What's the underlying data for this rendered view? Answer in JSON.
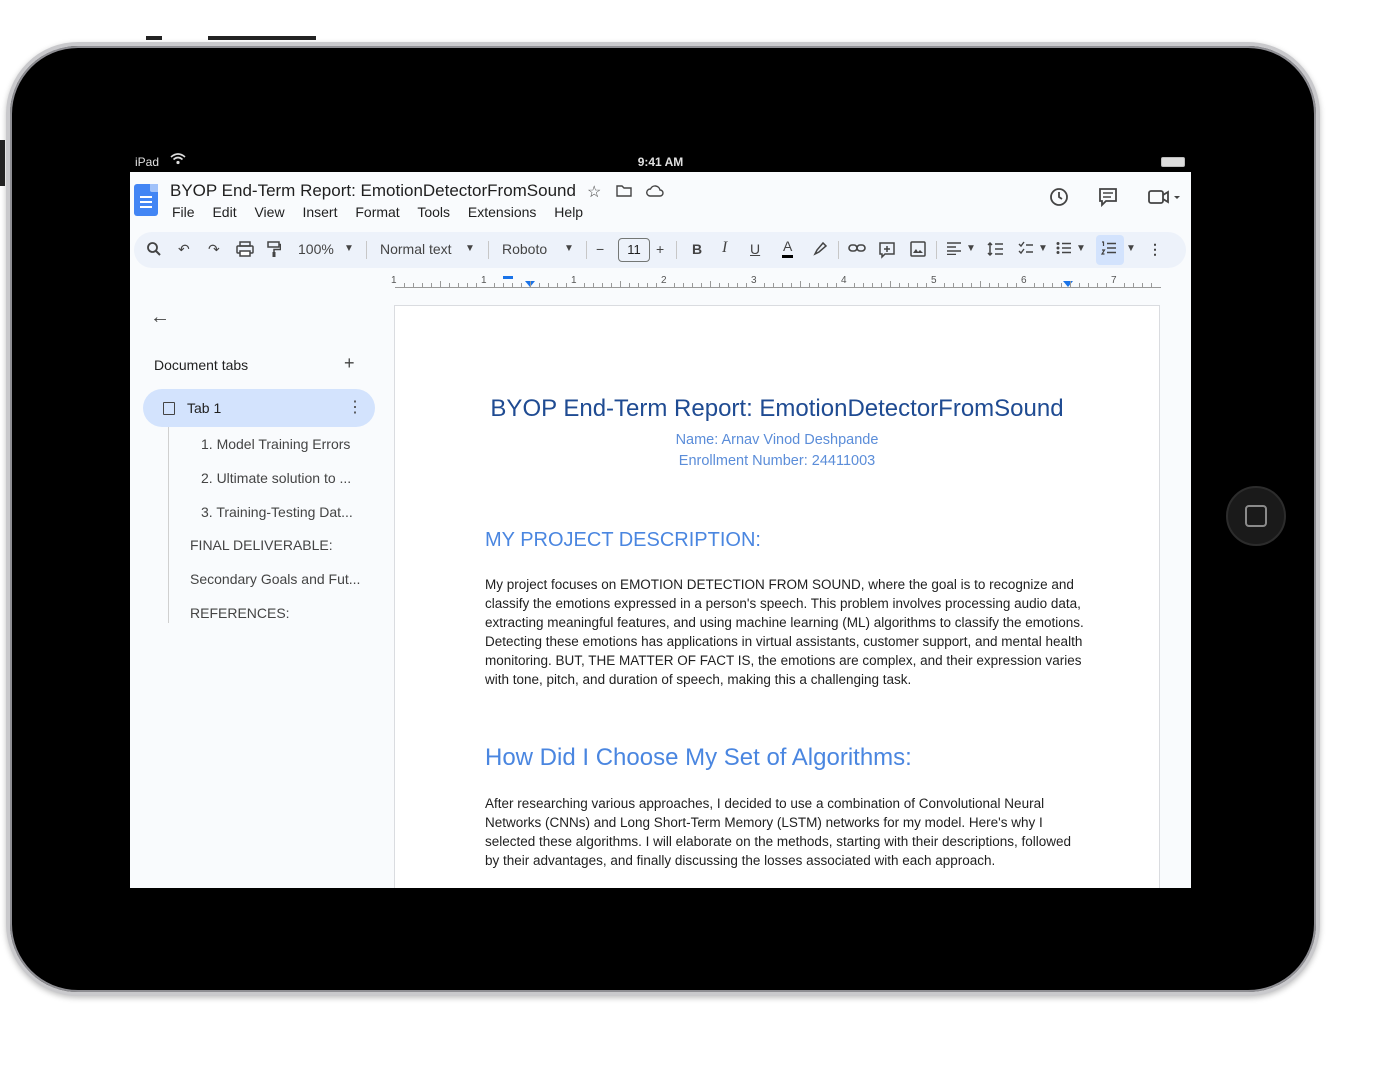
{
  "status_bar": {
    "device": "iPad",
    "time": "9:41 AM"
  },
  "document": {
    "title": "BYOP End-Term Report: EmotionDetectorFromSound"
  },
  "menu": [
    "File",
    "Edit",
    "View",
    "Insert",
    "Format",
    "Tools",
    "Extensions",
    "Help"
  ],
  "toolbar": {
    "zoom": "100%",
    "style": "Normal text",
    "font": "Roboto",
    "font_size": "11",
    "minus": "−",
    "plus": "+"
  },
  "ruler": {
    "numbers": [
      "1",
      "1",
      "1",
      "2",
      "3",
      "4",
      "5",
      "6",
      "7"
    ]
  },
  "sidebar": {
    "heading": "Document tabs",
    "tab_label": "Tab 1",
    "outline": [
      "1. Model Training Errors",
      "2. Ultimate solution to ...",
      "3. Training-Testing Dat...",
      "FINAL DELIVERABLE:",
      "Secondary Goals and Fut...",
      "REFERENCES:"
    ]
  },
  "page": {
    "title": "BYOP End-Term Report: EmotionDetectorFromSound",
    "name_line": "Name: Arnav Vinod Deshpande",
    "enrollment_line": "Enrollment Number: 24411003",
    "heading1": "MY PROJECT DESCRIPTION:",
    "para1": "My project focuses on EMOTION DETECTION FROM SOUND, where the goal is to recognize and classify the emotions expressed in a person's speech. This problem involves processing audio data, extracting meaningful features, and using machine learning (ML) algorithms to classify the emotions. Detecting these emotions has applications in virtual assistants, customer support, and mental health monitoring. BUT, THE MATTER OF FACT IS, the emotions are complex, and their expression varies with tone, pitch, and duration of speech, making this a challenging task.",
    "heading2": "How Did I Choose My Set of Algorithms:",
    "para2": "After researching various approaches, I decided to use a combination of Convolutional Neural Networks (CNNs) and Long Short-Term Memory (LSTM) networks for my model. Here's why I selected these algorithms. I will elaborate on the methods, starting with their descriptions, followed by their advantages, and finally discussing the losses associated with each approach."
  }
}
